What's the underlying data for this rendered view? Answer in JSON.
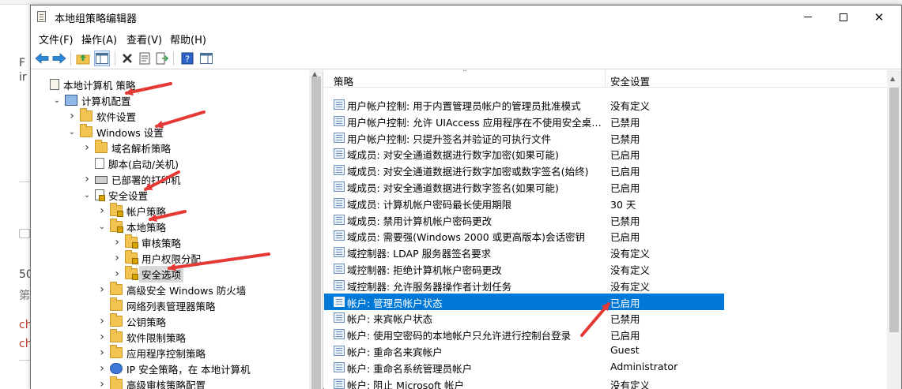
{
  "background": {
    "lines": [
      "F",
      "ir",
      "50",
      "第",
      "ch",
      "ch"
    ]
  },
  "window": {
    "title": "本地组策略编辑器",
    "controls": {
      "minimize": "—",
      "maximize": "☐",
      "close": "✕"
    }
  },
  "menu": [
    "文件(F)",
    "操作(A)",
    "查看(V)",
    "帮助(H)"
  ],
  "toolbar": {
    "icons": [
      "back-arrow-icon",
      "forward-arrow-icon",
      "up-folder-icon",
      "show-hide-tree-icon",
      "delete-icon",
      "properties-icon",
      "export-list-icon",
      "help-icon",
      "action-pane-icon"
    ]
  },
  "tree": {
    "items": [
      {
        "label": "本地计算机 策略",
        "indent": 0,
        "twisty": "",
        "icon": "policy-doc-icon"
      },
      {
        "label": "计算机配置",
        "indent": 1,
        "twisty": "open",
        "icon": "computer-icon"
      },
      {
        "label": "软件设置",
        "indent": 2,
        "twisty": "closed",
        "icon": "folder-icon"
      },
      {
        "label": "Windows 设置",
        "indent": 2,
        "twisty": "open",
        "icon": "folder-icon"
      },
      {
        "label": "域名解析策略",
        "indent": 3,
        "twisty": "closed",
        "icon": "folder-icon"
      },
      {
        "label": "脚本(启动/关机)",
        "indent": 3,
        "twisty": "",
        "icon": "script-icon"
      },
      {
        "label": "已部署的打印机",
        "indent": 3,
        "twisty": "closed",
        "icon": "printer-icon"
      },
      {
        "label": "安全设置",
        "indent": 3,
        "twisty": "open",
        "icon": "security-settings-icon"
      },
      {
        "label": "帐户策略",
        "indent": 4,
        "twisty": "closed",
        "icon": "folder-lock-icon"
      },
      {
        "label": "本地策略",
        "indent": 4,
        "twisty": "open",
        "icon": "folder-lock-icon"
      },
      {
        "label": "审核策略",
        "indent": 5,
        "twisty": "closed",
        "icon": "folder-lock-icon"
      },
      {
        "label": "用户权限分配",
        "indent": 5,
        "twisty": "closed",
        "icon": "folder-lock-icon"
      },
      {
        "label": "安全选项",
        "indent": 5,
        "twisty": "closed",
        "icon": "folder-lock-icon",
        "selected": true
      },
      {
        "label": "高级安全 Windows 防火墙",
        "indent": 4,
        "twisty": "closed",
        "icon": "folder-icon"
      },
      {
        "label": "网络列表管理器策略",
        "indent": 4,
        "twisty": "",
        "icon": "folder-icon"
      },
      {
        "label": "公钥策略",
        "indent": 4,
        "twisty": "closed",
        "icon": "folder-icon"
      },
      {
        "label": "软件限制策略",
        "indent": 4,
        "twisty": "closed",
        "icon": "folder-icon"
      },
      {
        "label": "应用程序控制策略",
        "indent": 4,
        "twisty": "closed",
        "icon": "folder-icon"
      },
      {
        "label": "IP 安全策略，在 本地计算机",
        "indent": 4,
        "twisty": "closed",
        "icon": "ip-security-icon"
      },
      {
        "label": "高级审核策略配置",
        "indent": 4,
        "twisty": "closed",
        "icon": "folder-icon"
      }
    ]
  },
  "list": {
    "columns": {
      "policy": "策略",
      "setting": "安全设置"
    },
    "rows": [
      {
        "policy": "用户帐户控制: 用于内置管理员帐户的管理员批准模式",
        "setting": "没有定义"
      },
      {
        "policy": "用户帐户控制: 允许 UIAccess 应用程序在不使用安全桌面...",
        "setting": "已禁用"
      },
      {
        "policy": "用户帐户控制: 只提升签名并验证的可执行文件",
        "setting": "已禁用"
      },
      {
        "policy": "域成员: 对安全通道数据进行数字加密(如果可能)",
        "setting": "已启用"
      },
      {
        "policy": "域成员: 对安全通道数据进行数字加密或数字签名(始终)",
        "setting": "已启用"
      },
      {
        "policy": "域成员: 对安全通道数据进行数字签名(如果可能)",
        "setting": "已启用"
      },
      {
        "policy": "域成员: 计算机帐户密码最长使用期限",
        "setting": "30 天"
      },
      {
        "policy": "域成员: 禁用计算机帐户密码更改",
        "setting": "已禁用"
      },
      {
        "policy": "域成员: 需要强(Windows 2000 或更高版本)会话密钥",
        "setting": "已启用"
      },
      {
        "policy": "域控制器: LDAP 服务器签名要求",
        "setting": "没有定义"
      },
      {
        "policy": "域控制器: 拒绝计算机帐户密码更改",
        "setting": "没有定义"
      },
      {
        "policy": "域控制器: 允许服务器操作者计划任务",
        "setting": "没有定义"
      },
      {
        "policy": "帐户: 管理员帐户状态",
        "setting": "已启用",
        "selected": true
      },
      {
        "policy": "帐户: 来宾帐户状态",
        "setting": "已禁用"
      },
      {
        "policy": "帐户: 使用空密码的本地帐户只允许进行控制台登录",
        "setting": "已启用"
      },
      {
        "policy": "帐户: 重命名来宾帐户",
        "setting": "Guest"
      },
      {
        "policy": "帐户: 重命名系统管理员帐户",
        "setting": "Administrator"
      },
      {
        "policy": "帐户: 阻止 Microsoft 帐户",
        "setting": "没有定义"
      }
    ]
  },
  "colors": {
    "selection": "#0078d7",
    "annotation": "#e53935",
    "folder": "#f2c34e"
  }
}
